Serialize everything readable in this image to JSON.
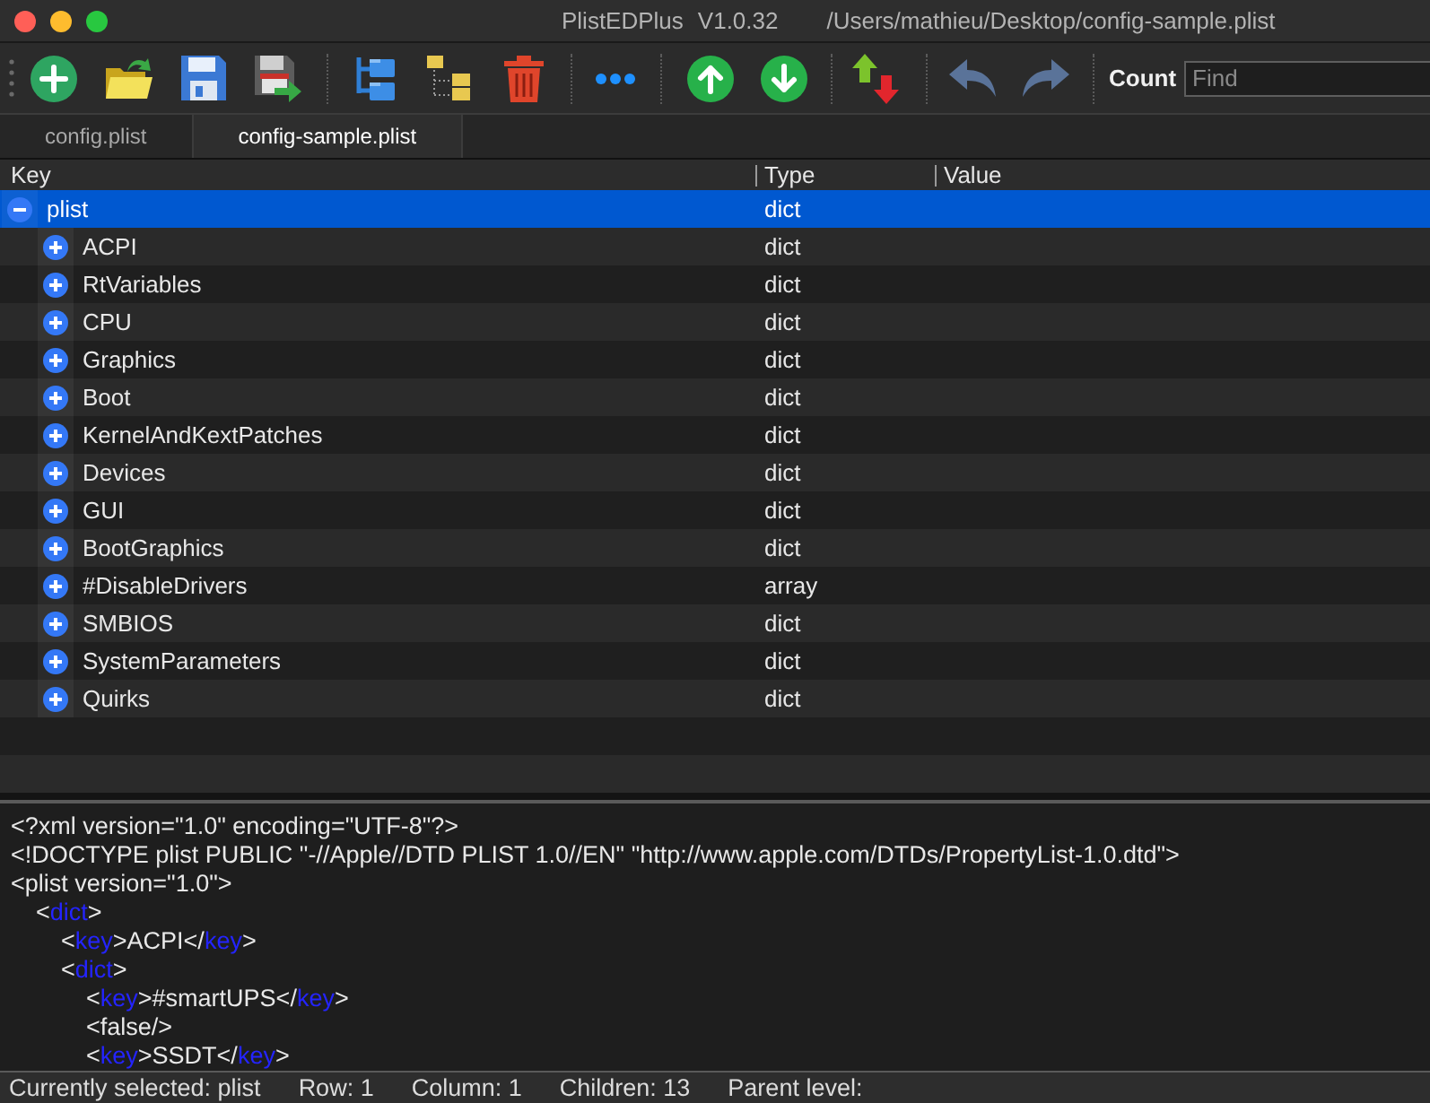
{
  "window": {
    "app_name": "PlistEDPlus",
    "version": "V1.0.32",
    "path": "/Users/mathieu/Desktop/config-sample.plist"
  },
  "toolbar": {
    "count_label": "Count",
    "search": {
      "placeholder": "Find"
    }
  },
  "tabs": [
    {
      "label": "config.plist",
      "selected": false
    },
    {
      "label": "config-sample.plist",
      "selected": true
    }
  ],
  "tree": {
    "columns": [
      "Key",
      "Type",
      "Value"
    ],
    "rows": [
      {
        "key": "plist",
        "type": "dict",
        "selected": true,
        "expanded": true,
        "children": [
          {
            "key": "ACPI",
            "type": "dict",
            "selected": false,
            "expanded": false
          },
          {
            "key": "RtVariables",
            "type": "dict",
            "selected": false,
            "expanded": false
          },
          {
            "key": "CPU",
            "type": "dict",
            "selected": false,
            "expanded": false
          },
          {
            "key": "Graphics",
            "type": "dict",
            "selected": false,
            "expanded": false
          },
          {
            "key": "Boot",
            "type": "dict",
            "selected": false,
            "expanded": false
          },
          {
            "key": "KernelAndKextPatches",
            "type": "dict",
            "selected": false,
            "expanded": false
          },
          {
            "key": "Devices",
            "type": "dict",
            "selected": false,
            "expanded": false
          },
          {
            "key": "GUI",
            "type": "dict",
            "selected": false,
            "expanded": false
          },
          {
            "key": "BootGraphics",
            "type": "dict",
            "selected": false,
            "expanded": false
          },
          {
            "key": "#DisableDrivers",
            "type": "array",
            "selected": false,
            "expanded": false
          },
          {
            "key": "SMBIOS",
            "type": "dict",
            "selected": false,
            "expanded": false
          },
          {
            "key": "SystemParameters",
            "type": "dict",
            "selected": false,
            "expanded": false
          },
          {
            "key": "Quirks",
            "type": "dict",
            "selected": false,
            "expanded": false
          }
        ]
      }
    ]
  },
  "xml_view": {
    "lines": [
      {
        "parts": [
          {
            "kind": "text",
            "text": "<?xml version=\"1.0\" encoding=\"UTF-8\"?>"
          }
        ]
      },
      {
        "parts": [
          {
            "kind": "text",
            "text": "<!DOCTYPE plist PUBLIC \"-//Apple//DTD PLIST 1.0//EN\" \"http://www.apple.com/DTDs/PropertyList-1.0.dtd\">"
          }
        ]
      },
      {
        "parts": [
          {
            "kind": "text",
            "text": "<plist version=\"1.0\">"
          }
        ],
        "children": [
          {
            "parts": [
              {
                "kind": "text",
                "text": "<"
              },
              {
                "kind": "tag",
                "text": "dict"
              },
              {
                "kind": "text",
                "text": ">"
              }
            ],
            "children": [
              {
                "parts": [
                  {
                    "kind": "text",
                    "text": "<"
                  },
                  {
                    "kind": "tag",
                    "text": "key"
                  },
                  {
                    "kind": "text",
                    "text": ">ACPI</"
                  },
                  {
                    "kind": "tag",
                    "text": "key"
                  },
                  {
                    "kind": "text",
                    "text": ">"
                  }
                ]
              },
              {
                "parts": [
                  {
                    "kind": "text",
                    "text": "<"
                  },
                  {
                    "kind": "tag",
                    "text": "dict"
                  },
                  {
                    "kind": "text",
                    "text": ">"
                  }
                ],
                "children": [
                  {
                    "parts": [
                      {
                        "kind": "text",
                        "text": "<"
                      },
                      {
                        "kind": "tag",
                        "text": "key"
                      },
                      {
                        "kind": "text",
                        "text": ">#smartUPS</"
                      },
                      {
                        "kind": "tag",
                        "text": "key"
                      },
                      {
                        "kind": "text",
                        "text": ">"
                      }
                    ]
                  },
                  {
                    "parts": [
                      {
                        "kind": "text",
                        "text": "<false/>"
                      }
                    ]
                  },
                  {
                    "parts": [
                      {
                        "kind": "text",
                        "text": "<"
                      },
                      {
                        "kind": "tag",
                        "text": "key"
                      },
                      {
                        "kind": "text",
                        "text": ">SSDT</"
                      },
                      {
                        "kind": "tag",
                        "text": "key"
                      },
                      {
                        "kind": "text",
                        "text": ">"
                      }
                    ]
                  }
                ]
              }
            ]
          }
        ]
      }
    ]
  },
  "status_bar": [
    "Currently selected: plist",
    "Row: 1",
    "Column: 1",
    "Children: 13",
    "Parent level:"
  ]
}
